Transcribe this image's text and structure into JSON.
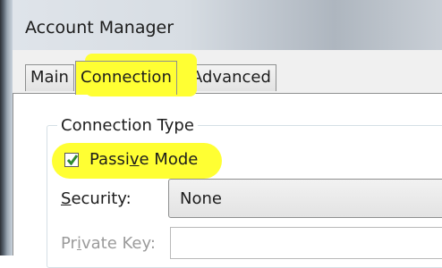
{
  "window": {
    "title": "Account Manager"
  },
  "tabs": [
    {
      "label": "Main",
      "active": false
    },
    {
      "label": "Connection",
      "active": true
    },
    {
      "label": "Advanced",
      "active": false
    }
  ],
  "connection_type": {
    "group_label": "Connection Type",
    "passive_mode": {
      "pre": "Passi",
      "mnemonic": "v",
      "post": "e Mode",
      "checked": true
    },
    "security": {
      "mnemonic": "S",
      "rest": "ecurity:",
      "value": "None"
    },
    "private_key": {
      "pre": "Pr",
      "mnemonic": "i",
      "post": "vate Key:",
      "value": ""
    }
  },
  "colors": {
    "highlight": "#ffff33",
    "check": "#2e8b2e"
  }
}
